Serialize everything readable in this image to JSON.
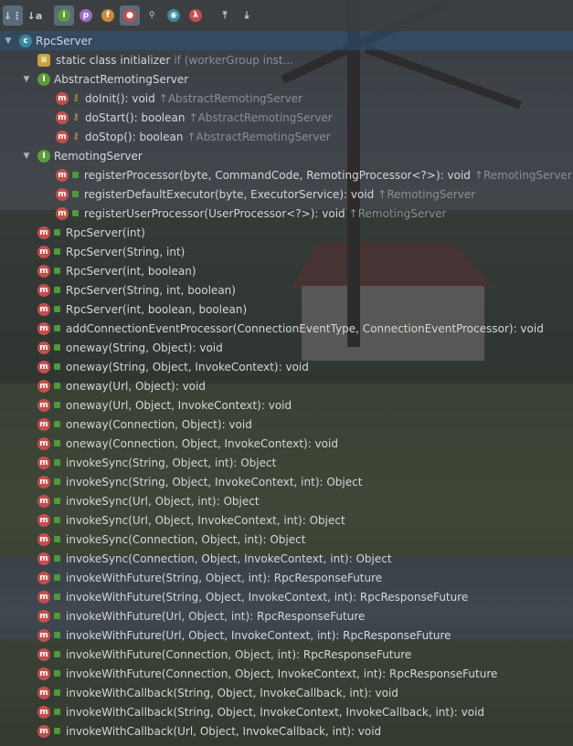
{
  "toolbar": {
    "buttons": [
      {
        "name": "sort-by-visibility-icon",
        "glyph": "↓⋮",
        "on": true
      },
      {
        "name": "sort-alphabetically-icon",
        "glyph": "↓a",
        "on": false
      },
      {
        "name": "show-inherited-icon",
        "glyph": "I",
        "color": "#5d9a3b",
        "on": true
      },
      {
        "name": "show-properties-icon",
        "glyph": "p",
        "color": "#9a6fc0",
        "on": false
      },
      {
        "name": "show-fields-icon",
        "glyph": "f",
        "color": "#c88a3a",
        "on": false
      },
      {
        "name": "show-non-public-icon",
        "glyph": "●",
        "color": "#c0504d",
        "on": true
      },
      {
        "name": "show-anonymous-icon",
        "glyph": "⚲",
        "color": "#c9cdd2",
        "on": false
      },
      {
        "name": "show-lambdas-icon",
        "glyph": "◉",
        "color": "#3e86a0",
        "on": false
      },
      {
        "name": "show-lambda-icon",
        "glyph": "λ",
        "color": "#c0504d",
        "on": false
      },
      {
        "name": "expand-all-icon",
        "glyph": "⤒",
        "on": false
      },
      {
        "name": "collapse-all-icon",
        "glyph": "⤓",
        "on": false
      }
    ]
  },
  "tree": [
    {
      "level": 0,
      "arrow": "▼",
      "icon": "c",
      "text": "RpcServer",
      "sel": true
    },
    {
      "level": 1,
      "icon": "st",
      "text": "static class initializer",
      "inh": "if (workerGroup inst..."
    },
    {
      "level": 1,
      "arrow": "▼",
      "icon": "i",
      "text": "AbstractRemotingServer"
    },
    {
      "level": 2,
      "icon": "m",
      "vis": "prot",
      "text": "doInit(): void",
      "inh": "↑AbstractRemotingServer"
    },
    {
      "level": 2,
      "icon": "m",
      "vis": "prot",
      "text": "doStart(): boolean",
      "inh": "↑AbstractRemotingServer"
    },
    {
      "level": 2,
      "icon": "m",
      "vis": "prot",
      "text": "doStop(): boolean",
      "inh": "↑AbstractRemotingServer"
    },
    {
      "level": 1,
      "arrow": "▼",
      "icon": "i",
      "text": "RemotingServer"
    },
    {
      "level": 2,
      "icon": "m",
      "vis": "pub",
      "text": "registerProcessor(byte, CommandCode, RemotingProcessor<?>): void",
      "inh": "↑RemotingServer"
    },
    {
      "level": 2,
      "icon": "m",
      "vis": "pub",
      "text": "registerDefaultExecutor(byte, ExecutorService): void",
      "inh": "↑RemotingServer"
    },
    {
      "level": 2,
      "icon": "m",
      "vis": "pub",
      "text": "registerUserProcessor(UserProcessor<?>): void",
      "inh": "↑RemotingServer"
    },
    {
      "level": 1,
      "icon": "m",
      "vis": "pub",
      "text": "RpcServer(int)"
    },
    {
      "level": 1,
      "icon": "m",
      "vis": "pub",
      "text": "RpcServer(String, int)"
    },
    {
      "level": 1,
      "icon": "m",
      "vis": "pub",
      "text": "RpcServer(int, boolean)"
    },
    {
      "level": 1,
      "icon": "m",
      "vis": "pub",
      "text": "RpcServer(String, int, boolean)"
    },
    {
      "level": 1,
      "icon": "m",
      "vis": "pub",
      "text": "RpcServer(int, boolean, boolean)"
    },
    {
      "level": 1,
      "icon": "m",
      "vis": "pub",
      "text": "addConnectionEventProcessor(ConnectionEventType, ConnectionEventProcessor): void"
    },
    {
      "level": 1,
      "icon": "m",
      "vis": "pub",
      "text": "oneway(String, Object): void"
    },
    {
      "level": 1,
      "icon": "m",
      "vis": "pub",
      "text": "oneway(String, Object, InvokeContext): void"
    },
    {
      "level": 1,
      "icon": "m",
      "vis": "pub",
      "text": "oneway(Url, Object): void"
    },
    {
      "level": 1,
      "icon": "m",
      "vis": "pub",
      "text": "oneway(Url, Object, InvokeContext): void"
    },
    {
      "level": 1,
      "icon": "m",
      "vis": "pub",
      "text": "oneway(Connection, Object): void"
    },
    {
      "level": 1,
      "icon": "m",
      "vis": "pub",
      "text": "oneway(Connection, Object, InvokeContext): void"
    },
    {
      "level": 1,
      "icon": "m",
      "vis": "pub",
      "text": "invokeSync(String, Object, int): Object"
    },
    {
      "level": 1,
      "icon": "m",
      "vis": "pub",
      "text": "invokeSync(String, Object, InvokeContext, int): Object"
    },
    {
      "level": 1,
      "icon": "m",
      "vis": "pub",
      "text": "invokeSync(Url, Object, int): Object"
    },
    {
      "level": 1,
      "icon": "m",
      "vis": "pub",
      "text": "invokeSync(Url, Object, InvokeContext, int): Object"
    },
    {
      "level": 1,
      "icon": "m",
      "vis": "pub",
      "text": "invokeSync(Connection, Object, int): Object"
    },
    {
      "level": 1,
      "icon": "m",
      "vis": "pub",
      "text": "invokeSync(Connection, Object, InvokeContext, int): Object"
    },
    {
      "level": 1,
      "icon": "m",
      "vis": "pub",
      "text": "invokeWithFuture(String, Object, int): RpcResponseFuture"
    },
    {
      "level": 1,
      "icon": "m",
      "vis": "pub",
      "text": "invokeWithFuture(String, Object, InvokeContext, int): RpcResponseFuture"
    },
    {
      "level": 1,
      "icon": "m",
      "vis": "pub",
      "text": "invokeWithFuture(Url, Object, int): RpcResponseFuture"
    },
    {
      "level": 1,
      "icon": "m",
      "vis": "pub",
      "text": "invokeWithFuture(Url, Object, InvokeContext, int): RpcResponseFuture"
    },
    {
      "level": 1,
      "icon": "m",
      "vis": "pub",
      "text": "invokeWithFuture(Connection, Object, int): RpcResponseFuture"
    },
    {
      "level": 1,
      "icon": "m",
      "vis": "pub",
      "text": "invokeWithFuture(Connection, Object, InvokeContext, int): RpcResponseFuture"
    },
    {
      "level": 1,
      "icon": "m",
      "vis": "pub",
      "text": "invokeWithCallback(String, Object, InvokeCallback, int): void"
    },
    {
      "level": 1,
      "icon": "m",
      "vis": "pub",
      "text": "invokeWithCallback(String, Object, InvokeContext, InvokeCallback, int): void"
    },
    {
      "level": 1,
      "icon": "m",
      "vis": "pub",
      "text": "invokeWithCallback(Url, Object, InvokeCallback, int): void"
    }
  ]
}
